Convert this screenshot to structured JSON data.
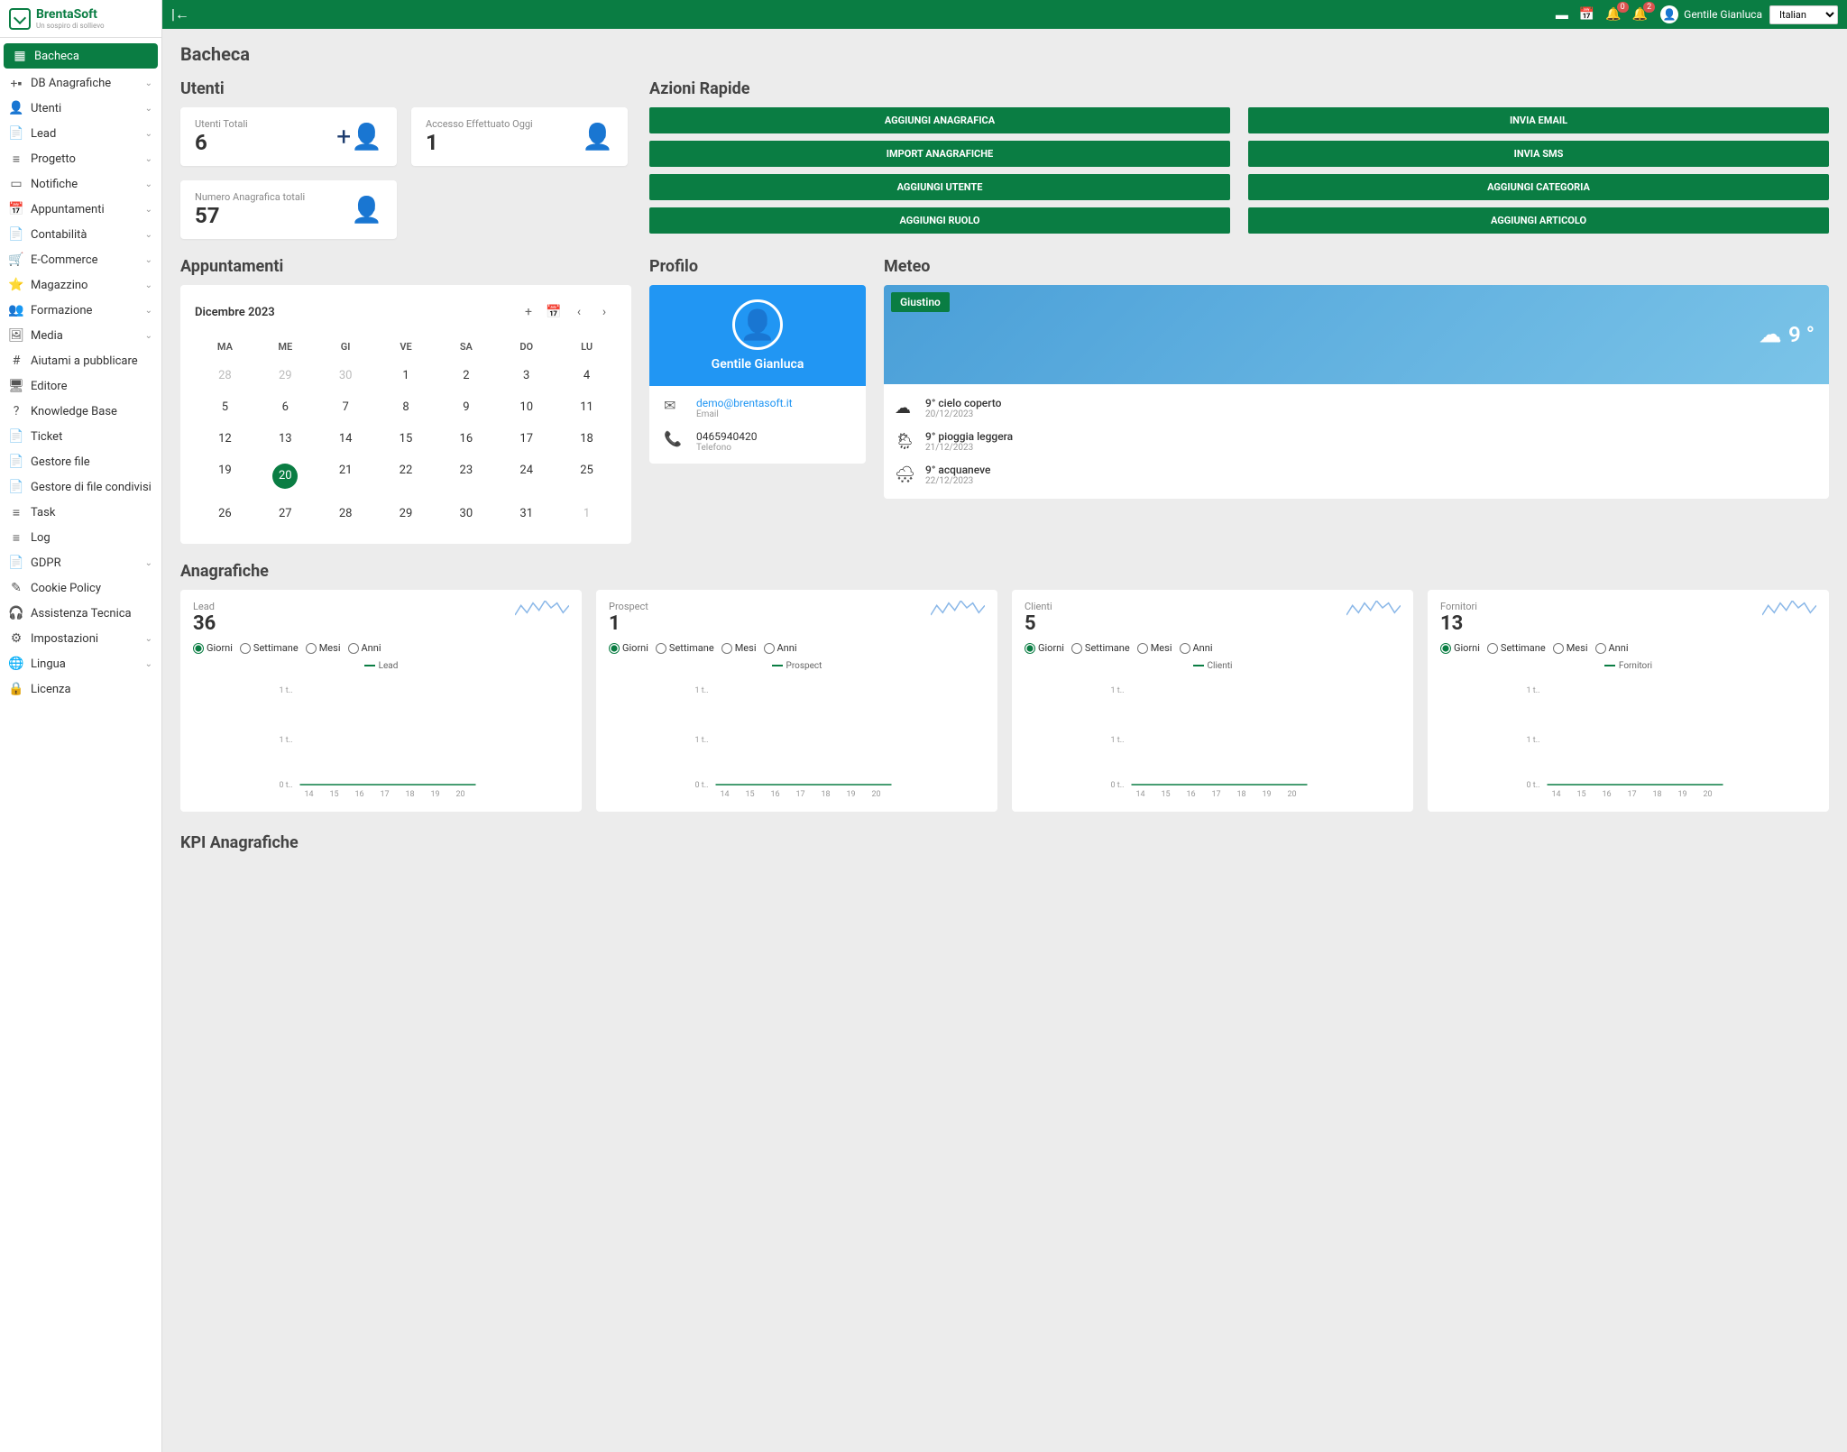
{
  "brand": {
    "name": "BrentaSoft",
    "tagline": "Un sospiro di sollievo"
  },
  "topbar": {
    "user_name": "Gentile Gianluca",
    "language": "Italian",
    "notif1_badge": "0",
    "notif2_badge": "2"
  },
  "nav": [
    {
      "label": "Bacheca",
      "icon": "▦",
      "active": true
    },
    {
      "label": "DB Anagrafiche",
      "icon": "+▪",
      "expand": true
    },
    {
      "label": "Utenti",
      "icon": "👤",
      "expand": true
    },
    {
      "label": "Lead",
      "icon": "📄",
      "expand": true
    },
    {
      "label": "Progetto",
      "icon": "≡",
      "expand": true
    },
    {
      "label": "Notifiche",
      "icon": "▭",
      "expand": true
    },
    {
      "label": "Appuntamenti",
      "icon": "📅",
      "expand": true
    },
    {
      "label": "Contabilità",
      "icon": "📄",
      "expand": true
    },
    {
      "label": "E-Commerce",
      "icon": "🛒",
      "expand": true
    },
    {
      "label": "Magazzino",
      "icon": "⭐",
      "expand": true
    },
    {
      "label": "Formazione",
      "icon": "👥",
      "expand": true
    },
    {
      "label": "Media",
      "icon": "🖼",
      "expand": true
    },
    {
      "label": "Aiutami a pubblicare",
      "icon": "#"
    },
    {
      "label": "Editore",
      "icon": "🖥"
    },
    {
      "label": "Knowledge Base",
      "icon": "?"
    },
    {
      "label": "Ticket",
      "icon": "📄"
    },
    {
      "label": "Gestore file",
      "icon": "📄"
    },
    {
      "label": "Gestore di file condivisi",
      "icon": "📄"
    },
    {
      "label": "Task",
      "icon": "≡"
    },
    {
      "label": "Log",
      "icon": "≡"
    },
    {
      "label": "GDPR",
      "icon": "📄",
      "expand": true
    },
    {
      "label": "Cookie Policy",
      "icon": "✎"
    },
    {
      "label": "Assistenza Tecnica",
      "icon": "🎧"
    },
    {
      "label": "Impostazioni",
      "icon": "⚙",
      "expand": true
    },
    {
      "label": "Lingua",
      "icon": "🌐",
      "expand": true
    },
    {
      "label": "Licenza",
      "icon": "🔒"
    }
  ],
  "page_title": "Bacheca",
  "sections": {
    "utenti_title": "Utenti",
    "azioni_title": "Azioni Rapide",
    "appuntamenti_title": "Appuntamenti",
    "profilo_title": "Profilo",
    "meteo_title": "Meteo",
    "anagrafiche_title": "Anagrafiche",
    "kpi_title": "KPI Anagrafiche"
  },
  "stats": [
    {
      "label": "Utenti Totali",
      "value": "6",
      "icon": "person-add"
    },
    {
      "label": "Accesso Effettuato Oggi",
      "value": "1",
      "icon": "person"
    },
    {
      "label": "Numero Anagrafica totali",
      "value": "57",
      "icon": "person"
    }
  ],
  "quick_actions": {
    "left": [
      "AGGIUNGI ANAGRAFICA",
      "IMPORT ANAGRAFICHE",
      "AGGIUNGI UTENTE",
      "AGGIUNGI RUOLO"
    ],
    "right": [
      "INVIA EMAIL",
      "INVIA SMS",
      "AGGIUNGI CATEGORIA",
      "AGGIUNGI ARTICOLO"
    ]
  },
  "calendar": {
    "month_label": "Dicembre 2023",
    "dow": [
      "MA",
      "ME",
      "GI",
      "VE",
      "SA",
      "DO",
      "LU"
    ],
    "days": [
      {
        "d": "28",
        "muted": true
      },
      {
        "d": "29",
        "muted": true
      },
      {
        "d": "30",
        "muted": true
      },
      {
        "d": "1"
      },
      {
        "d": "2"
      },
      {
        "d": "3"
      },
      {
        "d": "4"
      },
      {
        "d": "5"
      },
      {
        "d": "6"
      },
      {
        "d": "7"
      },
      {
        "d": "8"
      },
      {
        "d": "9"
      },
      {
        "d": "10"
      },
      {
        "d": "11"
      },
      {
        "d": "12"
      },
      {
        "d": "13"
      },
      {
        "d": "14"
      },
      {
        "d": "15"
      },
      {
        "d": "16"
      },
      {
        "d": "17"
      },
      {
        "d": "18"
      },
      {
        "d": "19"
      },
      {
        "d": "20",
        "today": true
      },
      {
        "d": "21"
      },
      {
        "d": "22"
      },
      {
        "d": "23"
      },
      {
        "d": "24"
      },
      {
        "d": "25"
      },
      {
        "d": "26"
      },
      {
        "d": "27"
      },
      {
        "d": "28"
      },
      {
        "d": "29"
      },
      {
        "d": "30"
      },
      {
        "d": "31"
      },
      {
        "d": "1",
        "muted": true
      }
    ]
  },
  "profile": {
    "name": "Gentile Gianluca",
    "email": "demo@brentasoft.it",
    "email_label": "Email",
    "phone": "0465940420",
    "phone_label": "Telefono"
  },
  "meteo": {
    "location": "Giustino",
    "current_temp": "9 °",
    "forecast": [
      {
        "cond": "9° cielo coperto",
        "date": "20/12/2023",
        "icon": "☁"
      },
      {
        "cond": "9° pioggia leggera",
        "date": "21/12/2023",
        "icon": "🌦"
      },
      {
        "cond": "9° acquaneve",
        "date": "22/12/2023",
        "icon": "🌨"
      }
    ]
  },
  "anagrafiche": [
    {
      "label": "Lead",
      "value": "36",
      "legend": "Lead"
    },
    {
      "label": "Prospect",
      "value": "1",
      "legend": "Prospect"
    },
    {
      "label": "Clienti",
      "value": "5",
      "legend": "Clienti"
    },
    {
      "label": "Fornitori",
      "value": "13",
      "legend": "Fornitori"
    }
  ],
  "radio_labels": [
    "Giorni",
    "Settimane",
    "Mesi",
    "Anni"
  ],
  "chart_data": {
    "type": "line",
    "note": "four small line charts, one per anagrafiche card; y-axis shows 0 t.. and 1 t.. ticks; x-axis 14..20",
    "x": [
      14,
      15,
      16,
      17,
      18,
      19,
      20
    ],
    "ylim": [
      0,
      1.1
    ],
    "y_ticks": [
      "0 t..",
      "1 t..",
      "1 t.."
    ],
    "series": [
      {
        "name": "Lead",
        "values": [
          0,
          0,
          0,
          0,
          0,
          0,
          0
        ]
      },
      {
        "name": "Prospect",
        "values": [
          0,
          0,
          0,
          0,
          0,
          0,
          0
        ]
      },
      {
        "name": "Clienti",
        "values": [
          0,
          0,
          0,
          0,
          0,
          0,
          0
        ]
      },
      {
        "name": "Fornitori",
        "values": [
          0,
          0,
          0,
          0,
          0,
          0,
          0
        ]
      }
    ],
    "sparkline": {
      "note": "blue sparkline in card header",
      "values": [
        3,
        7,
        4,
        8,
        5,
        9,
        6,
        8,
        4,
        7
      ]
    }
  }
}
